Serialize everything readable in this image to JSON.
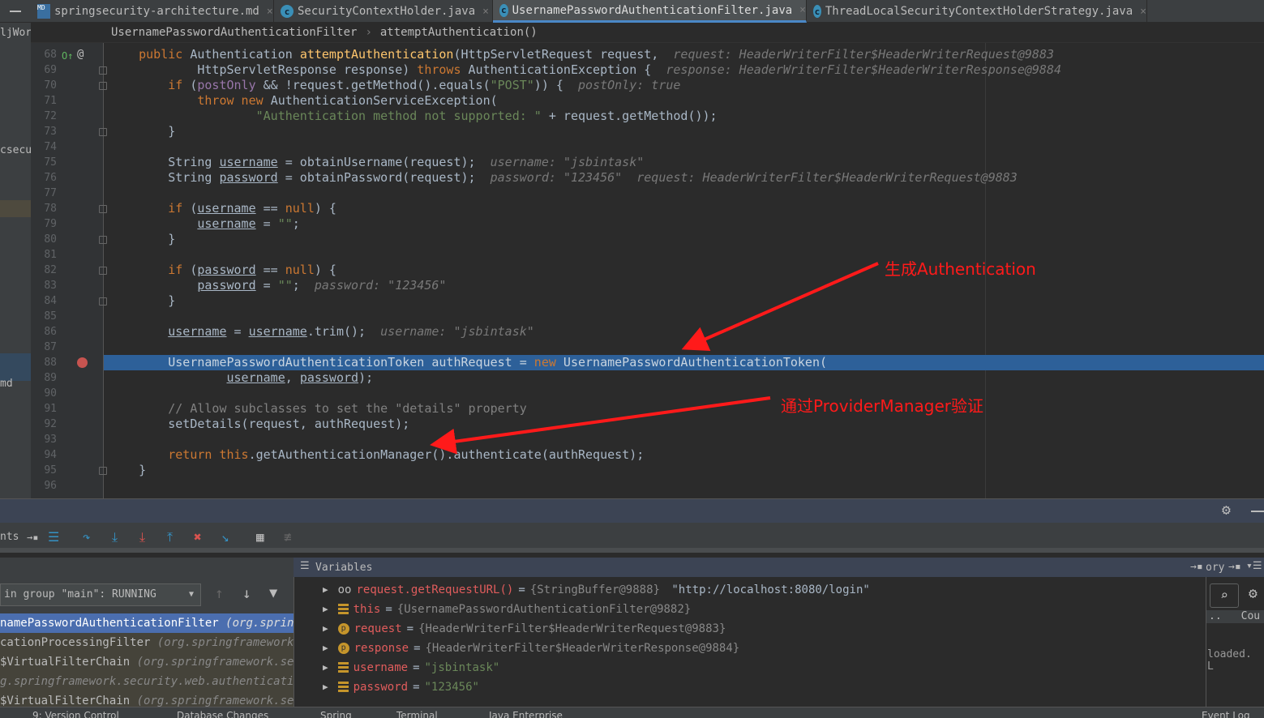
{
  "tabs": [
    {
      "label": "springsecurity-architecture.md",
      "icon": "markdown-file-icon"
    },
    {
      "label": "SecurityContextHolder.java",
      "icon": "java-class-icon"
    },
    {
      "label": "UsernamePasswordAuthenticationFilter.java",
      "icon": "java-class-icon",
      "active": true
    },
    {
      "label": "ThreadLocalSecurityContextHolderStrategy.java",
      "icon": "java-class-icon"
    }
  ],
  "breadcrumb": [
    "UsernamePasswordAuthenticationFilter",
    "attemptAuthentication()"
  ],
  "left_strip": [
    "ljWor",
    "csecu",
    "md"
  ],
  "line_numbers": [
    "68",
    "69",
    "70",
    "71",
    "72",
    "73",
    "74",
    "75",
    "76",
    "77",
    "78",
    "79",
    "80",
    "81",
    "82",
    "83",
    "84",
    "85",
    "86",
    "87",
    "88",
    "89",
    "90",
    "91",
    "92",
    "93",
    "94",
    "95",
    "96"
  ],
  "code": [
    [
      [
        "    ",
        ""
      ],
      [
        "public ",
        "k"
      ],
      [
        "Authentication ",
        ""
      ],
      [
        "attemptAuthentication",
        "m"
      ],
      [
        "(HttpServletRequest request,  ",
        ""
      ],
      [
        "request: HeaderWriterFilter$HeaderWriterRequest@9883",
        "h"
      ]
    ],
    [
      [
        "            HttpServletResponse response) ",
        ""
      ],
      [
        "throws ",
        "k"
      ],
      [
        "AuthenticationException {  ",
        ""
      ],
      [
        "response: HeaderWriterFilter$HeaderWriterResponse@9884",
        "h"
      ]
    ],
    [
      [
        "        ",
        ""
      ],
      [
        "if ",
        "k"
      ],
      [
        "(",
        ""
      ],
      [
        "postOnly",
        "f"
      ],
      [
        " && !request.getMethod().equals(",
        ""
      ],
      [
        "\"POST\"",
        "s"
      ],
      [
        ")) {  ",
        ""
      ],
      [
        "postOnly: true",
        "h"
      ]
    ],
    [
      [
        "            ",
        ""
      ],
      [
        "throw new ",
        "k"
      ],
      [
        "AuthenticationServiceException(",
        ""
      ]
    ],
    [
      [
        "                    ",
        ""
      ],
      [
        "\"Authentication method not supported: \"",
        "s"
      ],
      [
        " + request.getMethod());",
        ""
      ]
    ],
    [
      [
        "        }",
        ""
      ]
    ],
    [],
    [
      [
        "        String ",
        ""
      ],
      [
        "username",
        "u"
      ],
      [
        " = obtainUsername(request);  ",
        ""
      ],
      [
        "username: \"jsbintask\"",
        "h"
      ]
    ],
    [
      [
        "        String ",
        ""
      ],
      [
        "password",
        "u"
      ],
      [
        " = obtainPassword(request);  ",
        ""
      ],
      [
        "password: \"123456\"  request: HeaderWriterFilter$HeaderWriterRequest@9883",
        "h"
      ]
    ],
    [],
    [
      [
        "        ",
        ""
      ],
      [
        "if ",
        "k"
      ],
      [
        "(",
        ""
      ],
      [
        "username",
        "u"
      ],
      [
        " == ",
        ""
      ],
      [
        "null",
        "k"
      ],
      [
        ") {",
        ""
      ]
    ],
    [
      [
        "            ",
        ""
      ],
      [
        "username",
        "u"
      ],
      [
        " = ",
        ""
      ],
      [
        "\"\"",
        "s"
      ],
      [
        ";",
        ""
      ]
    ],
    [
      [
        "        }",
        ""
      ]
    ],
    [],
    [
      [
        "        ",
        ""
      ],
      [
        "if ",
        "k"
      ],
      [
        "(",
        ""
      ],
      [
        "password",
        "u"
      ],
      [
        " == ",
        ""
      ],
      [
        "null",
        "k"
      ],
      [
        ") {",
        ""
      ]
    ],
    [
      [
        "            ",
        ""
      ],
      [
        "password",
        "u"
      ],
      [
        " = ",
        ""
      ],
      [
        "\"\"",
        "s"
      ],
      [
        ";  ",
        ""
      ],
      [
        "password: \"123456\"",
        "h"
      ]
    ],
    [
      [
        "        }",
        ""
      ]
    ],
    [],
    [
      [
        "        ",
        ""
      ],
      [
        "username",
        "u"
      ],
      [
        " = ",
        ""
      ],
      [
        "username",
        "u"
      ],
      [
        ".trim();  ",
        ""
      ],
      [
        "username: \"jsbintask\"",
        "h"
      ]
    ],
    [],
    [
      [
        "        UsernamePasswordAuthenticationToken authRequest = ",
        ""
      ],
      [
        "new ",
        "k"
      ],
      [
        "UsernamePasswordAuthenticationToken(",
        ""
      ]
    ],
    [
      [
        "                ",
        ""
      ],
      [
        "username",
        "u"
      ],
      [
        ", ",
        ""
      ],
      [
        "password",
        "u"
      ],
      [
        ");",
        ""
      ]
    ],
    [],
    [
      [
        "        ",
        ""
      ],
      [
        "// Allow subclasses to set the \"details\" property",
        "c"
      ]
    ],
    [
      [
        "        setDetails(request, authRequest);",
        ""
      ]
    ],
    [],
    [
      [
        "        ",
        ""
      ],
      [
        "return this",
        "k"
      ],
      [
        ".getAuthenticationManager().authenticate(authRequest);",
        ""
      ]
    ],
    [
      [
        "    }",
        ""
      ]
    ],
    []
  ],
  "highlighted_line": "88",
  "annotations": [
    "生成Authentication",
    "通过ProviderManager验证"
  ],
  "debugger": {
    "frames_label": "nts",
    "thread_selector": "in group \"main\": RUNNING",
    "frames": [
      {
        "name": "namePasswordAuthenticationFilter ",
        "pkg": "(org.springf",
        "selected": true
      },
      {
        "name": "cationProcessingFilter ",
        "pkg": "(org.springframework.se"
      },
      {
        "name": "$VirtualFilterChain ",
        "pkg": "(org.springframework.secu"
      },
      {
        "name": "",
        "pkg": "g.springframework.security.web.authentication."
      },
      {
        "name": "$VirtualFilterChain ",
        "pkg": "(org.springframework.secu"
      }
    ],
    "variables_title": "Variables",
    "variables": [
      {
        "icon": "watch-icon",
        "name": "request.getRequestURL()",
        "obj": "{StringBuffer@9888} ",
        "value": "\"http://localhost:8080/login\""
      },
      {
        "icon": "field-icon",
        "name": "this",
        "obj": "{UsernamePasswordAuthenticationFilter@9882}",
        "value": ""
      },
      {
        "icon": "parameter-icon",
        "name": "request",
        "obj": "{HeaderWriterFilter$HeaderWriterRequest@9883}",
        "value": ""
      },
      {
        "icon": "parameter-icon",
        "name": "response",
        "obj": "{HeaderWriterFilter$HeaderWriterResponse@9884}",
        "value": ""
      },
      {
        "icon": "field-icon",
        "name": "username",
        "obj": "",
        "value": "\"jsbintask\""
      },
      {
        "icon": "field-icon",
        "name": "password",
        "obj": "",
        "value": "\"123456\""
      }
    ],
    "right_tab": "ory",
    "watch_col": "Cou",
    "watch_text": "loaded. L"
  },
  "status_bar": [
    "9: Version Control",
    "Database Changes",
    "Spring",
    "Terminal",
    "Java Enterprise",
    "Event Log"
  ],
  "colors": {
    "keyword": "#cc7832",
    "string": "#6a8759",
    "highlight": "#2d6099",
    "annotation": "#ff1a1a"
  }
}
